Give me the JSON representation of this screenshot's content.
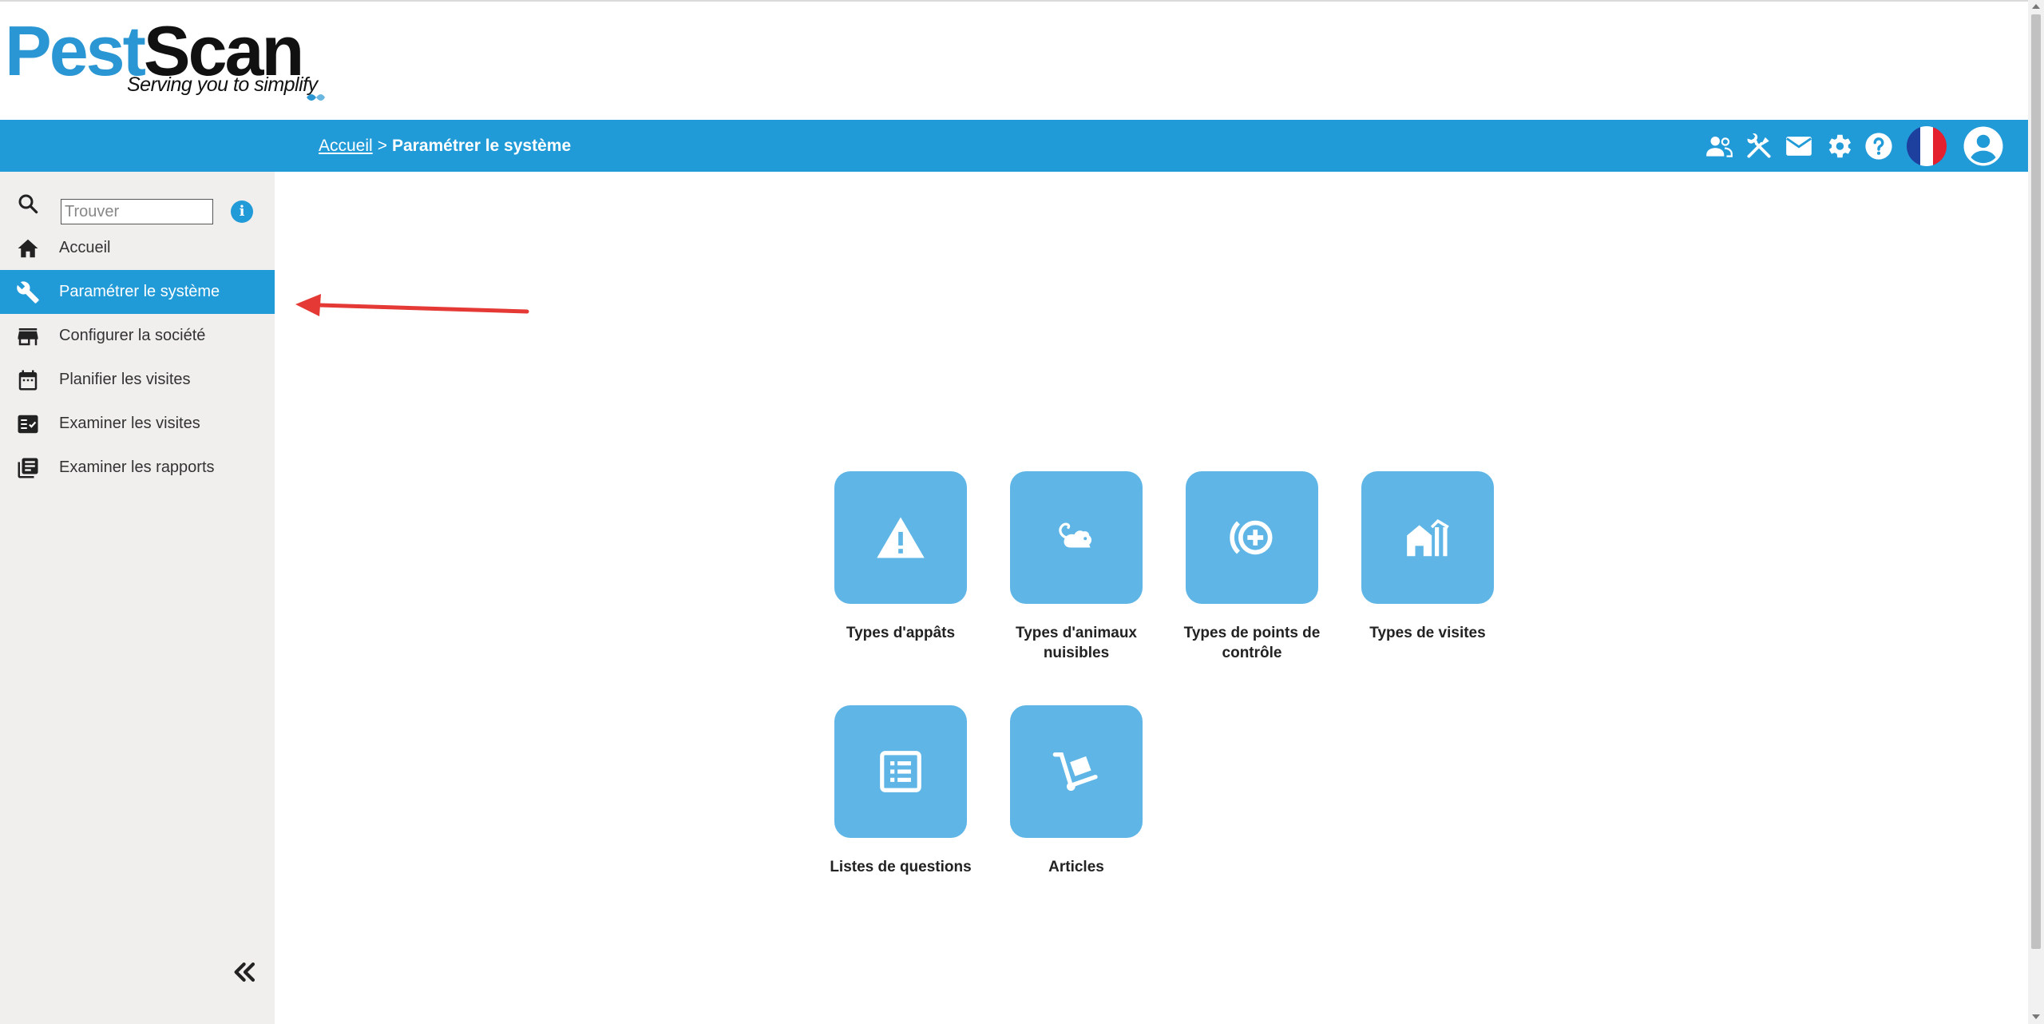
{
  "logo": {
    "part1": "Pest",
    "part2": "Scan",
    "tagline": "Serving you to simplify"
  },
  "breadcrumb": {
    "home": "Accueil",
    "separator": ">",
    "current": "Paramétrer le système"
  },
  "header_icons": [
    "users-icon",
    "tools-icon",
    "mail-icon",
    "gear-icon",
    "help-icon",
    "french-flag",
    "account-icon"
  ],
  "search": {
    "placeholder": "Trouver",
    "info": "i"
  },
  "sidebar": {
    "items": [
      {
        "label": "Accueil",
        "icon": "home-icon"
      },
      {
        "label": "Paramétrer le système",
        "icon": "wrench-icon",
        "active": true
      },
      {
        "label": "Configurer la société",
        "icon": "store-icon"
      },
      {
        "label": "Planifier les visites",
        "icon": "calendar-icon"
      },
      {
        "label": "Examiner les visites",
        "icon": "checklist-icon"
      },
      {
        "label": "Examiner les rapports",
        "icon": "reports-icon"
      }
    ],
    "collapse_icon": "double-chevron-left-icon"
  },
  "tiles": [
    {
      "label": "Types d'appâts",
      "icon": "warning-icon"
    },
    {
      "label": "Types d'animaux nuisibles",
      "icon": "rodent-icon"
    },
    {
      "label": "Types de points de contrôle",
      "icon": "control-point-icon"
    },
    {
      "label": "Types de visites",
      "icon": "building-icon"
    },
    {
      "label": "Listes de questions",
      "icon": "list-icon"
    },
    {
      "label": "Articles",
      "icon": "dolly-icon"
    }
  ],
  "colors": {
    "accent": "#219ad8",
    "tile": "#5fb6e6",
    "sidebar_bg": "#f0efee",
    "annotation_arrow": "#e53935"
  }
}
